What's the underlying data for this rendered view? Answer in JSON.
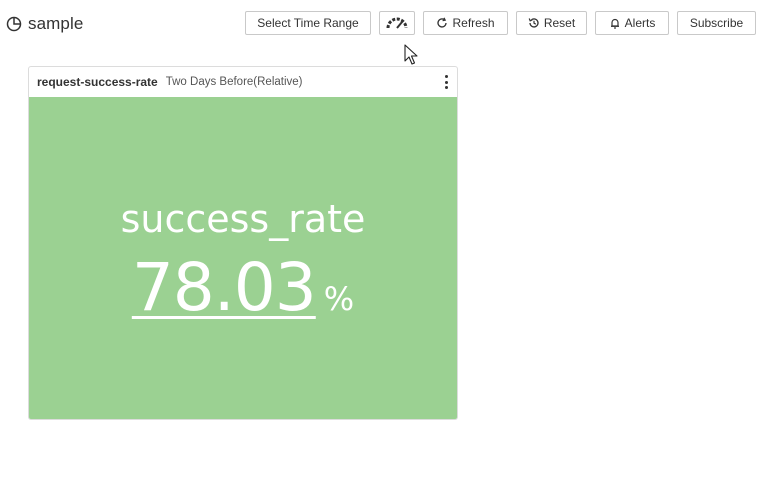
{
  "dashboard": {
    "title": "sample",
    "title_icon": "pie-chart-icon"
  },
  "toolbar": {
    "select_time_range_label": "Select Time Range",
    "speedometer_icon": "gauge-icon",
    "refresh_label": "Refresh",
    "refresh_icon": "refresh-icon",
    "reset_label": "Reset",
    "reset_icon": "history-icon",
    "alerts_label": "Alerts",
    "alerts_icon": "bell-icon",
    "subscribe_label": "Subscribe"
  },
  "panel": {
    "name": "request-success-rate",
    "time_range": "Two Days Before(Relative)",
    "menu_icon": "kebab-menu-icon",
    "background_color": "#9bd192",
    "metric": {
      "name": "success_rate",
      "value": "78.03",
      "unit": "%"
    }
  }
}
